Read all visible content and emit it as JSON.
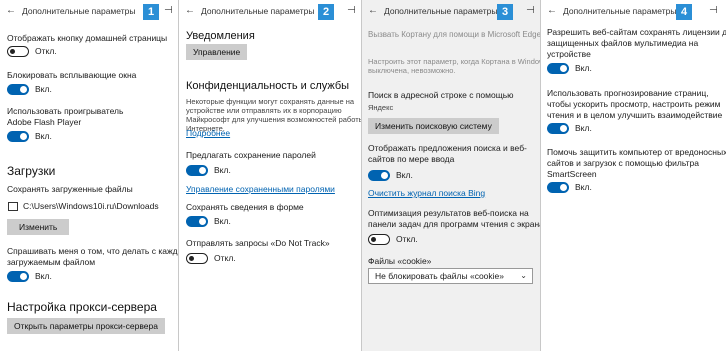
{
  "panels": [
    {
      "title": "Дополнительные параметры",
      "badge": "1",
      "home_button_label": "Отображать кнопку домашней страницы",
      "home_button_state": "Откл.",
      "block_popups_label": "Блокировать всплывающие окна",
      "block_popups_state": "Вкл.",
      "flash_label_1": "Использовать проигрыватель",
      "flash_label_2": "Adobe Flash Player",
      "flash_state": "Вкл.",
      "downloads_heading": "Загрузки",
      "save_downloads_label": "Сохранять загруженные файлы",
      "download_path": "C:\\Users\\Windows10i.ru\\Downloads",
      "change_button": "Изменить",
      "ask_label_1": "Спрашивать меня о том, что делать с каждым",
      "ask_label_2": "загружаемым файлом",
      "ask_state": "Вкл.",
      "proxy_heading": "Настройка прокси-сервера",
      "proxy_button": "Открыть параметры прокси-сервера"
    },
    {
      "title": "Дополнительные параметры",
      "badge": "2",
      "notifications_heading": "Уведомления",
      "manage_button": "Управление",
      "privacy_heading": "Конфиденциальность и службы",
      "privacy_desc_1": "Некоторые функции могут сохранять данные на",
      "privacy_desc_2": "устройстве или отправлять их в корпорацию",
      "privacy_desc_3": "Майкрософт для улучшения возможностей работы в",
      "privacy_desc_4": "Интернете.",
      "more_link": "Подробнее",
      "passwords_label": "Предлагать сохранение паролей",
      "passwords_state": "Вкл.",
      "manage_passwords_link": "Управление сохраненными паролями",
      "form_label": "Сохранять сведения в форме",
      "form_state": "Вкл.",
      "dnt_label": "Отправлять запросы «Do Not Track»",
      "dnt_state": "Откл."
    },
    {
      "title": "Дополнительные параметры",
      "badge": "3",
      "cortana_label": "Вызвать Кортану для помощи в Microsoft Edge",
      "cortana_note_1": "Настроить этот параметр, когда Кортана в Windows",
      "cortana_note_2": "выключена, невозможно.",
      "search_label": "Поиск в адресной строке с помощью",
      "search_engine": "Яндекс",
      "change_search_button": "Изменить поисковую систему",
      "suggest_label_1": "Отображать предложения поиска и веб-",
      "suggest_label_2": "сайтов по мере ввода",
      "suggest_state": "Вкл.",
      "clear_bing_link": "Очистить журнал поиска Bing",
      "optimize_label_1": "Оптимизация результатов веб-поиска на",
      "optimize_label_2": "панели задач для программ чтения с экрана",
      "optimize_state": "Откл.",
      "cookies_label": "Файлы «cookie»",
      "cookies_value": "Не блокировать файлы «cookie»"
    },
    {
      "title": "Дополнительные параметры",
      "badge": "4",
      "licenses_label_1": "Разрешить веб-сайтам сохранять лицензии для",
      "licenses_label_2": "защищенных файлов мультимедиа на",
      "licenses_label_3": "устройстве",
      "licenses_state": "Вкл.",
      "prediction_label_1": "Использовать прогнозирование страниц,",
      "prediction_label_2": "чтобы ускорить просмотр, настроить режим",
      "prediction_label_3": "чтения и в целом улучшить взаимодействие",
      "prediction_state": "Вкл.",
      "smartscreen_label_1": "Помочь защитить компьютер от вредоносных",
      "smartscreen_label_2": "сайтов и загрузок с помощью фильтра",
      "smartscreen_label_3": "SmartScreen",
      "smartscreen_state": "Вкл."
    }
  ],
  "icons": {
    "back": "←",
    "pin": "⊣",
    "chevron": "⌄"
  },
  "colors": {
    "accent": "#0063b1",
    "badge": "#2b8fd6",
    "button": "#cccccc",
    "link": "#0063b1"
  }
}
